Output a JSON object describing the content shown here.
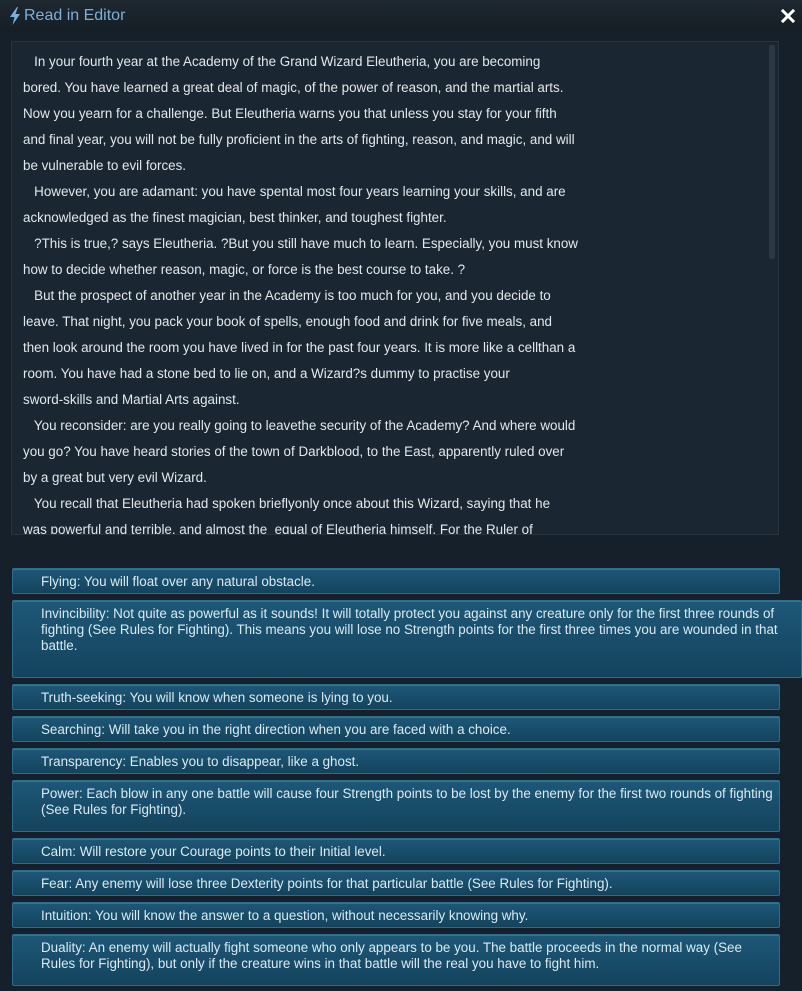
{
  "window": {
    "title": "Read in Editor",
    "accent": "#7cb0d8"
  },
  "editor": {
    "lines": [
      "   In your fourth year at the Academy of the Grand Wizard Eleutheria, you are becoming",
      "bored. You have learned a great deal of magic, of the power of reason, and the martial arts.",
      "Now you yearn for a challenge. But Eleutheria warns you that unless you stay for your fifth",
      "and final year, you will not be fully proficient in the arts of fighting, reason, and magic, and will",
      "be vulnerable to evil forces.",
      "   However, you are adamant: you have spental most four years learning your skills, and are",
      "acknowledged as the finest magician, best thinker, and toughest fighter.",
      "   ?This is true,? says Eleutheria. ?But you still have much to learn. Especially, you must know",
      "how to decide whether reason, magic, or force is the best course to take. ?",
      "   But the prospect of another year in the Academy is too much for you, and you decide to",
      "leave. That night, you pack your book of spells, enough food and drink for five meals, and",
      "then look around the room you have lived in for the past four years. It is more like a cellthan a",
      "room. You have had a stone bed to lie on, and a Wizard?s dummy to practise your",
      "sword-skills and Martial Arts against.",
      "   You reconsider: are you really going to leavethe security of the Academy? And where would",
      "you go? You have heard stories of the town of Darkblood, to the East, apparently ruled over",
      "by a great but very evil Wizard.",
      "   You recall that Eleutheria had spoken brieflyonly once about this Wizard, saying that he",
      "was powerful and terrible, and almost the  equal of Eleutheria himself. For the Ruler of"
    ]
  },
  "options": [
    {
      "text": "Flying: You will float over any natural obstacle."
    },
    {
      "text": "Invincibility: Not quite as powerful as it sounds! It will totally protect you against any creature only for the first three rounds of fighting (See Rules for Fighting). This means you will lose no Strength points for the first three times you are wounded in that battle."
    },
    {
      "text": "Truth-seeking: You will know when someone is lying to you."
    },
    {
      "text": "Searching: Will take you in the right direction when you are faced with a choice."
    },
    {
      "text": "Transparency: Enables you to disappear, like a ghost."
    },
    {
      "text": "Power: Each blow in any one battle will cause four Strength points to be lost by the enemy for the first two rounds of fighting (See Rules for Fighting)."
    },
    {
      "text": "Calm: Will restore your Courage points to their Initial level."
    },
    {
      "text": "Fear: Any enemy will lose three Dexterity points for that particular battle (See Rules for Fighting)."
    },
    {
      "text": "Intuition: You will know the answer to a question, without necessarily knowing why."
    },
    {
      "text": "Duality: An enemy will actually fight someone who only  appears  to be you. The battle proceeds in the normal way (See Rules for Fighting), but only if the creature wins in that battle will the real you have to fight him."
    }
  ],
  "icons": {
    "title": "lightning-icon",
    "close": "close-icon"
  }
}
